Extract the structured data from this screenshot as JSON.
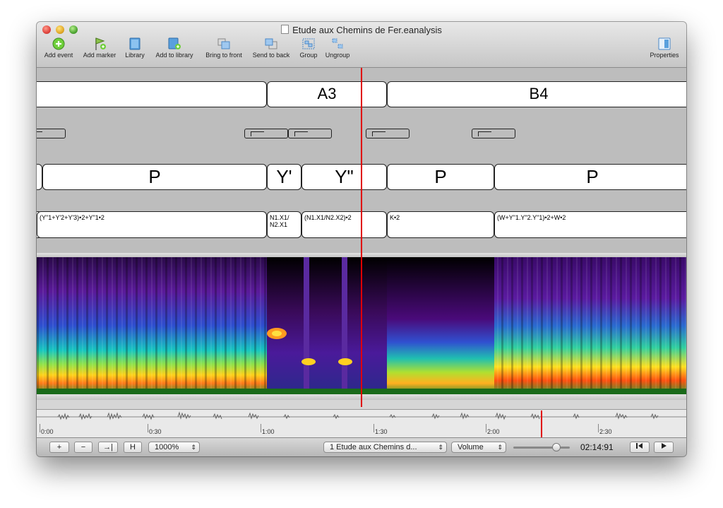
{
  "window": {
    "title": "Etude aux Chemins de Fer.eanalysis"
  },
  "toolbar": {
    "add_event": "Add event",
    "add_marker": "Add marker",
    "library": "Library",
    "add_to_library": "Add to library",
    "bring_to_front": "Bring to front",
    "send_to_back": "Send to back",
    "group": "Group",
    "ungroup": "Ungroup",
    "properties": "Properties"
  },
  "tracks": {
    "row1": [
      "",
      "A3",
      "B4"
    ],
    "row3": [
      "",
      "P",
      "Y'",
      "Y\"",
      "P",
      "P"
    ],
    "row4": [
      "",
      "(Y\"1+Y'2+Y'3)•2+Y\"1•2",
      "N1.X1/ N2.X1",
      "(N1.X1/N2.X2)•2",
      "K•2",
      "(W+Y\"1.Y\"2.Y\"1)•2+W•2"
    ]
  },
  "timeline": {
    "ticks": [
      "0:00",
      "0:30",
      "1:00",
      "1:30",
      "2:00",
      "2:30"
    ]
  },
  "bottombar": {
    "zoom_in": "+",
    "zoom_out": "−",
    "fit": "→|",
    "full": "H",
    "zoom_level": "1000%",
    "track_select": "1 Etude aux Chemins d...",
    "mode_select": "Volume",
    "timecode": "02:14:91"
  },
  "colors": {
    "playhead": "#e00000",
    "track_bg": "#bdbdbd"
  }
}
